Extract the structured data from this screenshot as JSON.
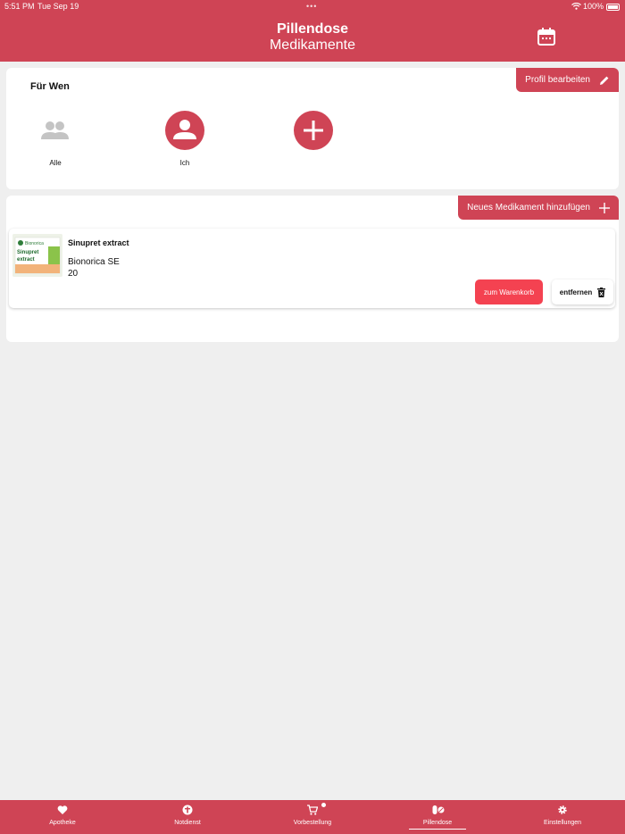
{
  "status_bar": {
    "time": "5:51 PM",
    "date": "Tue Sep 19",
    "battery": "100%"
  },
  "header": {
    "title": "Pillendose",
    "subtitle": "Medikamente",
    "calendar_icon": "calendar-icon"
  },
  "profiles": {
    "section_label": "Für Wen",
    "edit_button": "Profil bearbeiten",
    "people": [
      {
        "name": "Alle",
        "icon": "group-icon"
      },
      {
        "name": "Ich",
        "icon": "person-icon"
      }
    ],
    "add_icon": "plus-icon"
  },
  "medications": {
    "add_button": "Neues Medikament hinzufügen",
    "items": [
      {
        "name": "Sinupret extract",
        "manufacturer": "Bionorica SE",
        "quantity": "20",
        "cart_button": "zum Warenkorb",
        "remove_button": "entfernen",
        "image_text": {
          "brand": "Bionorica",
          "product": "Sinupret",
          "variant": "extract"
        }
      }
    ]
  },
  "tabs": [
    {
      "label": "Apotheke",
      "icon": "heart-icon"
    },
    {
      "label": "Notdienst",
      "icon": "emergency-icon"
    },
    {
      "label": "Vorbestellung",
      "icon": "cart-icon"
    },
    {
      "label": "Pillendose",
      "icon": "pills-icon",
      "active": true
    },
    {
      "label": "Einstellungen",
      "icon": "gear-icon"
    }
  ],
  "colors": {
    "primary": "#cf4455",
    "cart_button": "#f44251",
    "background": "#efefef"
  }
}
